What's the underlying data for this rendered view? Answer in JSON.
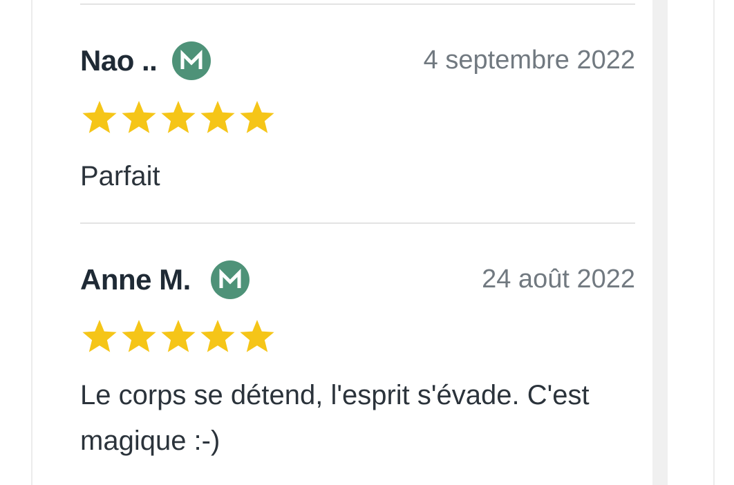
{
  "reviews": [
    {
      "name": "Nao ..",
      "date": "4 septembre 2022",
      "rating": 5,
      "max_rating": 5,
      "text": "Parfait",
      "verified_icon": "verified-m-badge-icon"
    },
    {
      "name": "Anne M.",
      "date": "24 août 2022",
      "rating": 5,
      "max_rating": 5,
      "text": "Le corps se détend, l'esprit s'évade. C'est magique :-)",
      "verified_icon": "verified-m-badge-icon"
    }
  ],
  "colors": {
    "star": "#f5c518",
    "badge": "#4e9278",
    "name": "#1f2a35",
    "date": "#717980",
    "text": "#2b333b",
    "divider": "#e3e3e3"
  }
}
